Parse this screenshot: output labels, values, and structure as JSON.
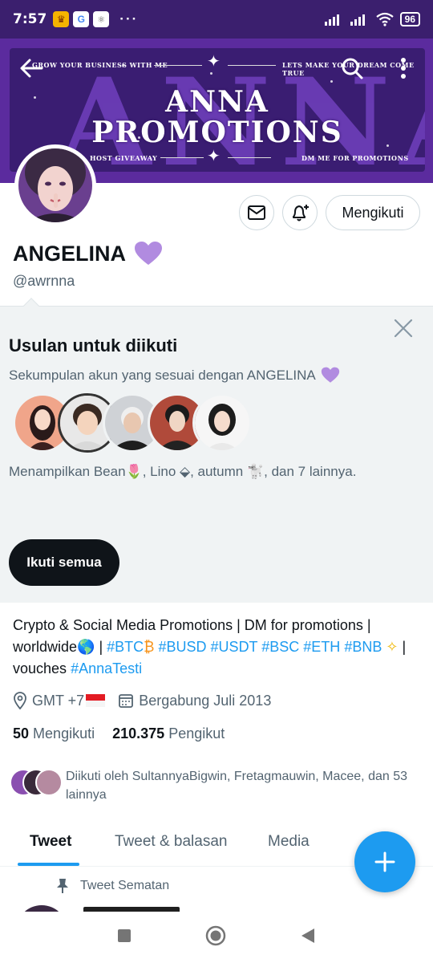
{
  "status_bar": {
    "time": "7:57",
    "more": "···",
    "battery": "96"
  },
  "banner": {
    "big_letters": "ANNA",
    "title_line1": "ANNA",
    "title_line2": "PROMOTIONS",
    "top_left_text": "GROW YOUR BUSINESS WITH ME",
    "top_right_text": "LETS MAKE YOUR DREAM COME TRUE",
    "bottom_left_text": "HOST GIVEAWAY",
    "bottom_right_text": "DM ME FOR PROMOTIONS"
  },
  "profile": {
    "name": "ANGELINA",
    "handle": "@awrnna",
    "follow_label": "Mengikuti"
  },
  "suggestions": {
    "title": "Usulan untuk diikuti",
    "subtitle": "Sekumpulan akun yang sesuai dengan ANGELINA",
    "names_text": "Menampilkan Bean🌷, Lino ⬙, autumn 🐩, dan 7 lainnya.",
    "follow_all_label": "Ikuti semua"
  },
  "bio": {
    "line1": "Crypto & Social Media Promotions | DM for promotions |",
    "worldwide": "worldwide🌎 |",
    "tag_btc": "#BTC",
    "emoji_btc": "₿",
    "tag_busd": "#BUSD",
    "tag_usdt": "#USDT",
    "tag_bsc": "#BSC",
    "tag_eth": "#ETH",
    "tag_bnb": "#BNB",
    "bnb_emoji": "✧",
    "pipe": "|",
    "vouches": "vouches",
    "tag_testi": "#AnnaTesti"
  },
  "meta": {
    "location": "GMT +7",
    "joined": "Bergabung Juli 2013"
  },
  "stats": {
    "following_count": "50",
    "following_label": "Mengikuti",
    "followers_count": "210.375",
    "followers_label": "Pengikut"
  },
  "followed_by": {
    "text": "Diikuti oleh SultannyaBigwin, Fretagmauwin, Macee, dan 53 lainnya"
  },
  "tabs": [
    {
      "label": "Tweet"
    },
    {
      "label": "Tweet & balasan"
    },
    {
      "label": "Media"
    }
  ],
  "pinned": {
    "label": "Tweet Sematan"
  },
  "colors": {
    "accent": "#1d9bf0",
    "heart": "#b18be0",
    "banner": "#3a1d72"
  }
}
